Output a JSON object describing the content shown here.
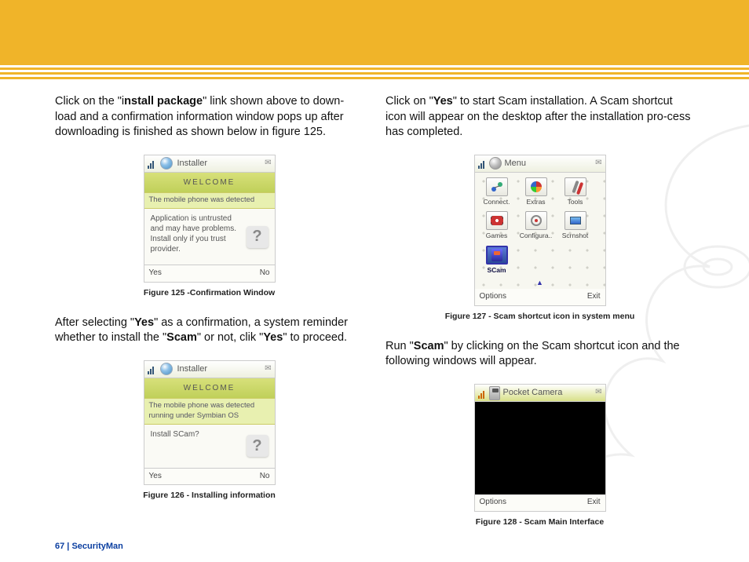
{
  "footer": {
    "page_num": "67",
    "sep": "  |  ",
    "brand": "SecurityMan"
  },
  "left": {
    "p1_a": "Click on the \"i",
    "p1_b": "nstall package",
    "p1_c": "\" link shown above to down-load and a confirmation information window pops up after downloading is finished as shown below in figure 125.",
    "p2_a": "After selecting \"",
    "p2_b": "Yes",
    "p2_c": "\" as a confirmation, a system reminder whether to install the \"",
    "p2_d": "Scam",
    "p2_e": "\" or not, clik \"",
    "p2_f": "Yes",
    "p2_g": "\" to proceed."
  },
  "right": {
    "p1_a": " Click on \"",
    "p1_b": "Yes",
    "p1_c": "\" to start Scam installation. A Scam shortcut icon will appear on the desktop after the installation pro-cess has completed.",
    "p2_a": "Run \"",
    "p2_b": "Scam",
    "p2_c": "\" by clicking on the Scam shortcut icon and the following windows will appear."
  },
  "fig125": {
    "caption": "Figure 125  -Confirmation Window",
    "title": "Installer",
    "banner": "WELCOME",
    "sub": "The mobile phone was detected",
    "msg": "Application is untrusted and may have problems. Install only if you trust provider.",
    "left_soft": "Yes",
    "right_soft": "No"
  },
  "fig126": {
    "caption": "Figure 126  - Installing information",
    "title": "Installer",
    "banner": "WELCOME",
    "sub": "The mobile phone was detected running under Symbian OS",
    "msg": "Install SCam?",
    "left_soft": "Yes",
    "right_soft": "No"
  },
  "fig127": {
    "caption": "Figure 127 - Scam shortcut icon in system menu",
    "title": "Menu",
    "icons": {
      "r0": [
        "Connect.",
        "Extras",
        "Tools"
      ],
      "r1": [
        "Games",
        "Configura..",
        "Scrnshot"
      ],
      "r2": [
        "SCam"
      ]
    },
    "left_soft": "Options",
    "right_soft": "Exit"
  },
  "fig128": {
    "caption": "Figure 128 - Scam Main Interface",
    "title": "Pocket Camera",
    "left_soft": "Options",
    "right_soft": "Exit"
  }
}
